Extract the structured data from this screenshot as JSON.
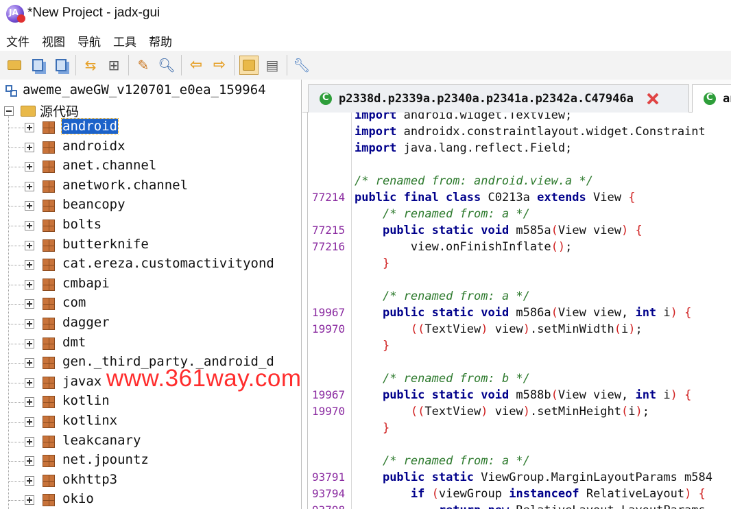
{
  "window": {
    "title": "*New Project - jadx-gui"
  },
  "menu": [
    "文件",
    "视图",
    "导航",
    "工具",
    "帮助"
  ],
  "toolbar": {
    "buttons": [
      "open-file-icon",
      "save-all-icon",
      "export-icon",
      "sync-icon",
      "flatten-icon",
      "wand-icon",
      "search-icon",
      "back-icon",
      "forward-icon",
      "decompile-icon",
      "log-icon",
      "settings-icon"
    ],
    "active": "decompile-icon"
  },
  "tree": {
    "root_label": "aweme_aweGW_v120701_e0ea_159964",
    "source_label": "源代码",
    "packages": [
      "android",
      "androidx",
      "anet.channel",
      "anetwork.channel",
      "beancopy",
      "bolts",
      "butterknife",
      "cat.ereza.customactivityond",
      "cmbapi",
      "com",
      "dagger",
      "dmt",
      "gen._third_party._android_d",
      "javax",
      "kotlin",
      "kotlinx",
      "leakcanary",
      "net.jpountz",
      "okhttp3",
      "okio"
    ],
    "selected": "android"
  },
  "watermark": "www.361way.com",
  "tabs": [
    {
      "label": "p2338d.p2339a.p2340a.p2341a.p2342a.C47946a",
      "closable": true
    },
    {
      "label": "an",
      "closable": false
    }
  ],
  "code": {
    "lines": [
      {
        "num": "",
        "tokens": [
          [
            "kw",
            "import"
          ],
          [
            "t",
            " android.widget.TextView;"
          ]
        ]
      },
      {
        "num": "",
        "tokens": [
          [
            "kw",
            "import"
          ],
          [
            "t",
            " androidx.constraintlayout.widget.Constraint"
          ]
        ]
      },
      {
        "num": "",
        "tokens": [
          [
            "kw",
            "import"
          ],
          [
            "t",
            " java.lang.reflect.Field;"
          ]
        ]
      },
      {
        "num": "",
        "tokens": []
      },
      {
        "num": "",
        "tokens": [
          [
            "cm",
            "/* renamed from: android.view.a */"
          ]
        ]
      },
      {
        "num": "77214",
        "tokens": [
          [
            "kw",
            "public final class"
          ],
          [
            "t",
            " C0213a "
          ],
          [
            "kw",
            "extends"
          ],
          [
            "t",
            " View "
          ],
          [
            "pr",
            "{"
          ]
        ]
      },
      {
        "num": "",
        "tokens": [
          [
            "t",
            "    "
          ],
          [
            "cm",
            "/* renamed from: a */"
          ]
        ]
      },
      {
        "num": "77215",
        "tokens": [
          [
            "t",
            "    "
          ],
          [
            "kw",
            "public static void"
          ],
          [
            "t",
            " m585a"
          ],
          [
            "pr",
            "("
          ],
          [
            "t",
            "View view"
          ],
          [
            "pr",
            ")"
          ],
          [
            "t",
            " "
          ],
          [
            "pr",
            "{"
          ]
        ]
      },
      {
        "num": "77216",
        "tokens": [
          [
            "t",
            "        view.onFinishInflate"
          ],
          [
            "pr",
            "()"
          ],
          [
            "t",
            ";"
          ]
        ]
      },
      {
        "num": "",
        "tokens": [
          [
            "t",
            "    "
          ],
          [
            "pr",
            "}"
          ]
        ]
      },
      {
        "num": "",
        "tokens": []
      },
      {
        "num": "",
        "tokens": [
          [
            "t",
            "    "
          ],
          [
            "cm",
            "/* renamed from: a */"
          ]
        ]
      },
      {
        "num": "19967",
        "tokens": [
          [
            "t",
            "    "
          ],
          [
            "kw",
            "public static void"
          ],
          [
            "t",
            " m586a"
          ],
          [
            "pr",
            "("
          ],
          [
            "t",
            "View view, "
          ],
          [
            "kw",
            "int"
          ],
          [
            "t",
            " i"
          ],
          [
            "pr",
            ")"
          ],
          [
            "t",
            " "
          ],
          [
            "pr",
            "{"
          ]
        ]
      },
      {
        "num": "19970",
        "tokens": [
          [
            "t",
            "        "
          ],
          [
            "pr",
            "(("
          ],
          [
            "t",
            "TextView"
          ],
          [
            "pr",
            ")"
          ],
          [
            "t",
            " view"
          ],
          [
            "pr",
            ")"
          ],
          [
            "t",
            ".setMinWidth"
          ],
          [
            "pr",
            "("
          ],
          [
            "t",
            "i"
          ],
          [
            "pr",
            ")"
          ],
          [
            "t",
            ";"
          ]
        ]
      },
      {
        "num": "",
        "tokens": [
          [
            "t",
            "    "
          ],
          [
            "pr",
            "}"
          ]
        ]
      },
      {
        "num": "",
        "tokens": []
      },
      {
        "num": "",
        "tokens": [
          [
            "t",
            "    "
          ],
          [
            "cm",
            "/* renamed from: b */"
          ]
        ]
      },
      {
        "num": "19967",
        "tokens": [
          [
            "t",
            "    "
          ],
          [
            "kw",
            "public static void"
          ],
          [
            "t",
            " m588b"
          ],
          [
            "pr",
            "("
          ],
          [
            "t",
            "View view, "
          ],
          [
            "kw",
            "int"
          ],
          [
            "t",
            " i"
          ],
          [
            "pr",
            ")"
          ],
          [
            "t",
            " "
          ],
          [
            "pr",
            "{"
          ]
        ]
      },
      {
        "num": "19970",
        "tokens": [
          [
            "t",
            "        "
          ],
          [
            "pr",
            "(("
          ],
          [
            "t",
            "TextView"
          ],
          [
            "pr",
            ")"
          ],
          [
            "t",
            " view"
          ],
          [
            "pr",
            ")"
          ],
          [
            "t",
            ".setMinHeight"
          ],
          [
            "pr",
            "("
          ],
          [
            "t",
            "i"
          ],
          [
            "pr",
            ")"
          ],
          [
            "t",
            ";"
          ]
        ]
      },
      {
        "num": "",
        "tokens": [
          [
            "t",
            "    "
          ],
          [
            "pr",
            "}"
          ]
        ]
      },
      {
        "num": "",
        "tokens": []
      },
      {
        "num": "",
        "tokens": [
          [
            "t",
            "    "
          ],
          [
            "cm",
            "/* renamed from: a */"
          ]
        ]
      },
      {
        "num": "93791",
        "tokens": [
          [
            "t",
            "    "
          ],
          [
            "kw",
            "public static"
          ],
          [
            "t",
            " ViewGroup.MarginLayoutParams m584"
          ]
        ]
      },
      {
        "num": "93794",
        "tokens": [
          [
            "t",
            "        "
          ],
          [
            "kw",
            "if"
          ],
          [
            "t",
            " "
          ],
          [
            "pr",
            "("
          ],
          [
            "t",
            "viewGroup "
          ],
          [
            "kw",
            "instanceof"
          ],
          [
            "t",
            " RelativeLayout"
          ],
          [
            "pr",
            ")"
          ],
          [
            "t",
            " "
          ],
          [
            "pr",
            "{"
          ]
        ]
      },
      {
        "num": "93798",
        "tokens": [
          [
            "t",
            "            "
          ],
          [
            "kw",
            "return new"
          ],
          [
            "t",
            " RelativeLayout.LayoutParams"
          ]
        ]
      }
    ]
  }
}
